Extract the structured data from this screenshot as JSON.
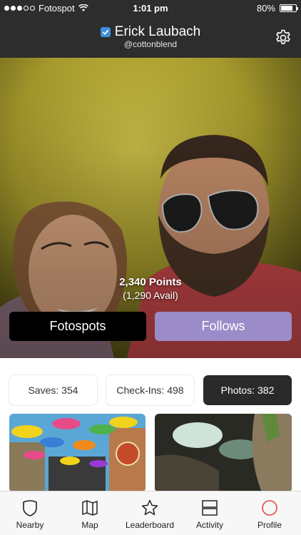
{
  "status_bar": {
    "carrier": "Fotospot",
    "time": "1:01 pm",
    "battery": "80%",
    "battery_level": 0.8
  },
  "header": {
    "name": "Erick Laubach",
    "handle": "@cottonblend",
    "verified_icon": "verified-check-icon",
    "settings_icon": "gear-icon"
  },
  "hero": {
    "points": "2,340 Points",
    "points_available": "(1,290 Avail)",
    "buttons": {
      "fotospots": "Fotospots",
      "follows": "Follows"
    }
  },
  "stats": {
    "saves": "Saves: 354",
    "checkins": "Check-Ins: 498",
    "photos": "Photos: 382"
  },
  "tabs": [
    {
      "label": "Nearby",
      "icon": "shield-icon"
    },
    {
      "label": "Map",
      "icon": "map-icon"
    },
    {
      "label": "Leaderboard",
      "icon": "star-icon"
    },
    {
      "label": "Activity",
      "icon": "activity-icon"
    },
    {
      "label": "Profile",
      "icon": "profile-circle-icon"
    }
  ],
  "colors": {
    "accent_follows": "#9c8bc9",
    "profile_tab": "#e04a4a",
    "verified": "#3f8fd8"
  }
}
